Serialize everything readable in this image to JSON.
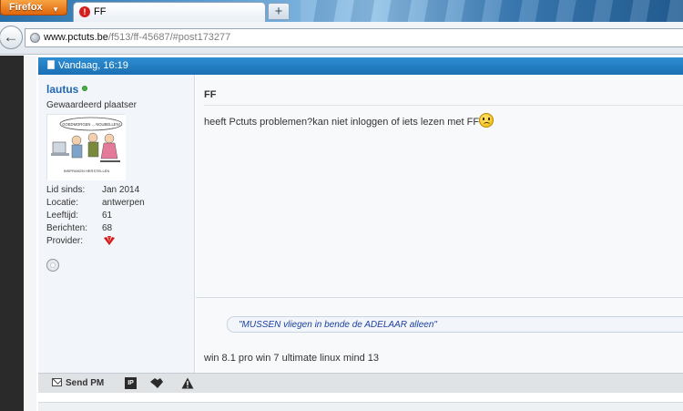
{
  "browser": {
    "menu_button_label": "Firefox",
    "tab_title": "FF",
    "new_tab_label": "+",
    "url_domain": "www.pctuts.be",
    "url_path": "/f513/ff-45687/#post173277"
  },
  "post": {
    "date": "Vandaag, 16:19",
    "user": {
      "name": "lautus",
      "title": "Gewaardeerd plaatser",
      "online": true,
      "stats": [
        {
          "label": "Lid sinds:",
          "value": "Jan 2014"
        },
        {
          "label": "Locatie:",
          "value": "antwerpen"
        },
        {
          "label": "Leeftijd:",
          "value": "61"
        },
        {
          "label": "Berichten:",
          "value": "68"
        },
        {
          "label": "Provider:",
          "value": ""
        }
      ],
      "avatar_caption_top": "GOEDMORGEN ... NOUBELLEN!",
      "avatar_caption_bottom": "INSPRAKEN    HERSTELLEN"
    },
    "title": "FF",
    "body": "heeft Pctuts problemen?kan niet inloggen of iets lezen met FF",
    "signature_quote": "\"MUSSEN vliegen in bende de ADELAAR alleen\"",
    "signature_text": "win 8.1 pro win 7 ultimate linux mind 13"
  },
  "footer": {
    "send_pm_label": "Send PM",
    "ip_icon_label": "IP"
  },
  "colors": {
    "header_blue": "#1a6fb3",
    "username_blue": "#2268b2",
    "signature_blue": "#1a3fa0",
    "firefox_orange": "#e0660d"
  }
}
